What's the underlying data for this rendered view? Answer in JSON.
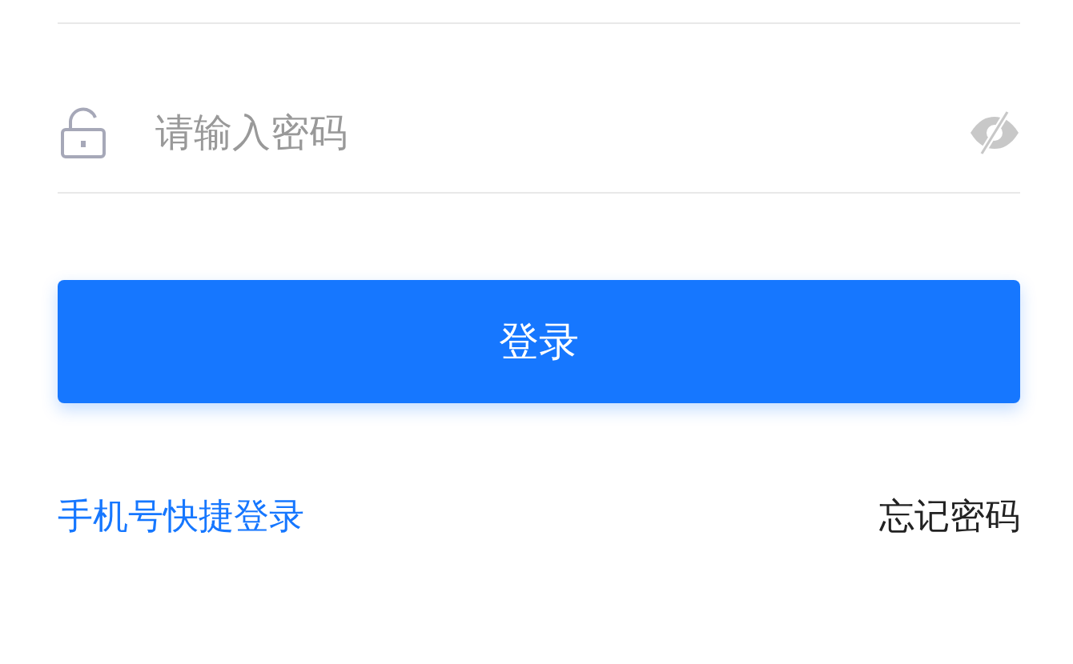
{
  "password_field": {
    "placeholder": "请输入密码",
    "password_visible": false
  },
  "login_button": {
    "label": "登录"
  },
  "links": [
    {
      "label": "手机号快捷登录",
      "kind": "primary"
    },
    {
      "label": "忘记密码",
      "kind": "plain"
    }
  ]
}
